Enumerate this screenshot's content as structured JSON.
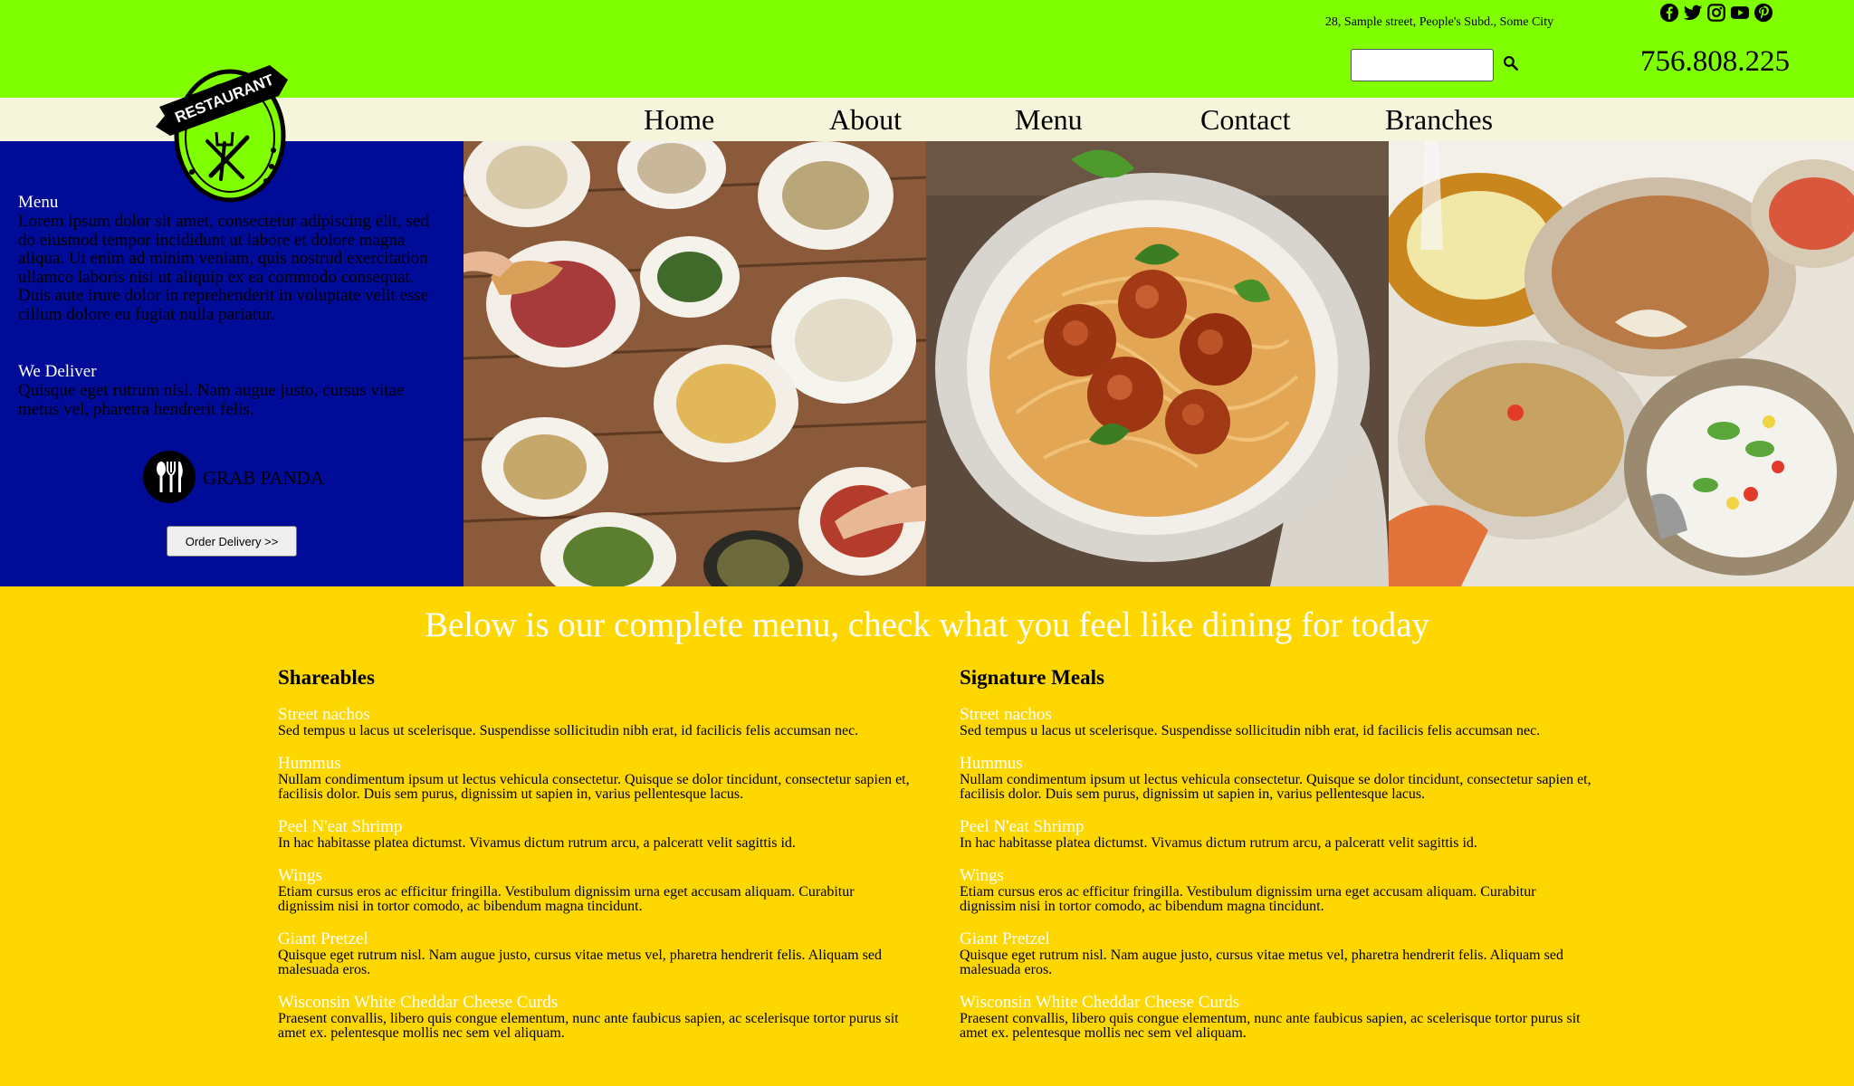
{
  "header": {
    "address": "28, Sample street, People's Subd., Some City",
    "phone": "756.808.225",
    "social_icons": [
      "facebook-icon",
      "twitter-icon",
      "instagram-icon",
      "youtube-icon",
      "pinterest-icon"
    ],
    "search": {
      "value": "",
      "placeholder": ""
    }
  },
  "logo": {
    "text": "RESTAURANT"
  },
  "nav": {
    "items": [
      "Home",
      "About",
      "Menu",
      "Contact",
      "Branches"
    ]
  },
  "panel": {
    "menu_title": "Menu",
    "menu_text": "Lorem ipsum dolor sit amet, consectetur adipiscing elit, sed do eiusmod tempor incididunt ut labore et dolore magna aliqua. Ut enim ad minim veniam, quis nostrud exercitation ullamco laboris nisi ut aliquip ex ea commodo consequat. Duis aute irure dolor in reprehenderit in voluptate velit esse cillum dolore eu fugiat nulla pariatur.",
    "deliver_title": "We Deliver",
    "deliver_text": "Quisque eget rutrum nisl. Nam augue justo, cursus vitae metus vel, pharetra hendrerit felis.",
    "partner_name": "GRAB PANDA",
    "order_button": "Order Delivery >>"
  },
  "headline": "Below is our complete menu, check what you feel like dining for today",
  "menus": [
    {
      "title": "Shareables",
      "items": [
        {
          "name": "Street nachos",
          "desc": "Sed tempus u lacus ut scelerisque. Suspendisse sollicitudin nibh erat, id facilicis felis accumsan nec."
        },
        {
          "name": "Hummus",
          "desc": "Nullam condimentum ipsum ut lectus vehicula consectetur. Quisque se dolor tincidunt, consectetur sapien et, facilisis dolor. Duis sem purus, dignissim ut sapien in, varius pellentesque lacus."
        },
        {
          "name": "Peel N'eat Shrimp",
          "desc": "In hac habitasse platea dictumst. Vivamus dictum rutrum arcu, a palceratt velit sagittis id."
        },
        {
          "name": "Wings",
          "desc": "Etiam cursus eros ac efficitur fringilla. Vestibulum dignissim urna eget accusam aliquam. Curabitur dignissim nisi in tortor comodo, ac bibendum magna tincidunt."
        },
        {
          "name": "Giant Pretzel",
          "desc": "Quisque eget rutrum nisl. Nam augue justo, cursus vitae metus vel, pharetra hendrerit felis. Aliquam sed malesuada eros."
        },
        {
          "name": "Wisconsin White Cheddar Cheese Curds",
          "desc": "Praesent convallis, libero quis congue elementum, nunc ante faubicus sapien, ac scelerisque tortor purus sit amet ex. pelentesque mollis nec sem vel aliquam."
        }
      ]
    },
    {
      "title": "Signature Meals",
      "items": [
        {
          "name": "Street nachos",
          "desc": "Sed tempus u lacus ut scelerisque. Suspendisse sollicitudin nibh erat, id facilicis felis accumsan nec."
        },
        {
          "name": "Hummus",
          "desc": "Nullam condimentum ipsum ut lectus vehicula consectetur. Quisque se dolor tincidunt, consectetur sapien et, facilisis dolor. Duis sem purus, dignissim ut sapien in, varius pellentesque lacus."
        },
        {
          "name": "Peel N'eat Shrimp",
          "desc": "In hac habitasse platea dictumst. Vivamus dictum rutrum arcu, a palceratt velit sagittis id."
        },
        {
          "name": "Wings",
          "desc": "Etiam cursus eros ac efficitur fringilla. Vestibulum dignissim urna eget accusam aliquam. Curabitur dignissim nisi in tortor comodo, ac bibendum magna tincidunt."
        },
        {
          "name": "Giant Pretzel",
          "desc": "Quisque eget rutrum nisl. Nam augue justo, cursus vitae metus vel, pharetra hendrerit felis. Aliquam sed malesuada eros."
        },
        {
          "name": "Wisconsin White Cheddar Cheese Curds",
          "desc": "Praesent convallis, libero quis congue elementum, nunc ante faubicus sapien, ac scelerisque tortor purus sit amet ex. pelentesque mollis nec sem vel aliquam."
        }
      ]
    }
  ],
  "colors": {
    "topbar": "#80ff00",
    "navbar": "#f5f5dc",
    "panel": "#000c98",
    "menu_background": "#ffd700"
  }
}
